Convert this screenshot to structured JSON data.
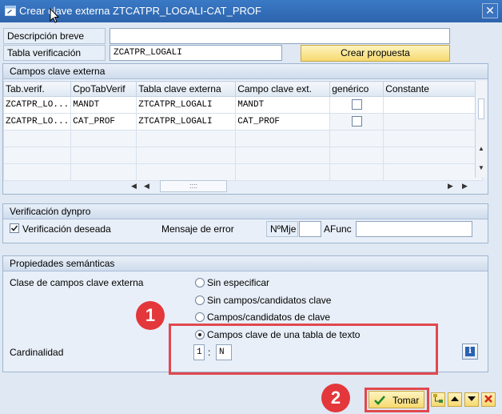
{
  "window": {
    "title": "Crear clave externa ZTCATPR_LOGALI-CAT_PROF",
    "close": "✕"
  },
  "fields": {
    "descripcion_label": "Descripción breve",
    "descripcion_value": "",
    "tabla_label": "Tabla verificación",
    "tabla_value": "ZCATPR_LOGALI",
    "crear_propuesta": "Crear propuesta"
  },
  "campos_clave": {
    "title": "Campos clave externa",
    "headers": [
      "Tab.verif.",
      "CpoTabVerif",
      "Tabla clave externa",
      "Campo clave ext.",
      "genérico",
      "Constante"
    ],
    "rows": [
      [
        "ZCATPR_LO...",
        "MANDT",
        "ZTCATPR_LOGALI",
        "MANDT",
        "",
        ""
      ],
      [
        "ZCATPR_LO...",
        "CAT_PROF",
        "ZTCATPR_LOGALI",
        "CAT_PROF",
        "",
        ""
      ]
    ],
    "scroll_handle": "::::"
  },
  "dynpro": {
    "title": "Verificación dynpro",
    "verificacion_label": "Verificación deseada",
    "verificacion_checked": true,
    "mensaje_label": "Mensaje de error",
    "nomje_label": "NºMje",
    "nomje_value": "",
    "afunc_label": "AFunc",
    "afunc_value": ""
  },
  "semanticas": {
    "title": "Propiedades semánticas",
    "clase_label": "Clase de campos clave externa",
    "options": [
      "Sin especificar",
      "Sin campos/candidatos clave",
      "Campos/candidatos de clave",
      "Campos clave de una tabla de texto"
    ],
    "selected_index": 3,
    "cardinalidad_label": "Cardinalidad",
    "card_left": "1",
    "card_sep": ":",
    "card_right": "N",
    "info_icon": "i"
  },
  "footer": {
    "tomar": "Tomar"
  },
  "annotations": {
    "callout1": "1",
    "callout2": "2"
  }
}
